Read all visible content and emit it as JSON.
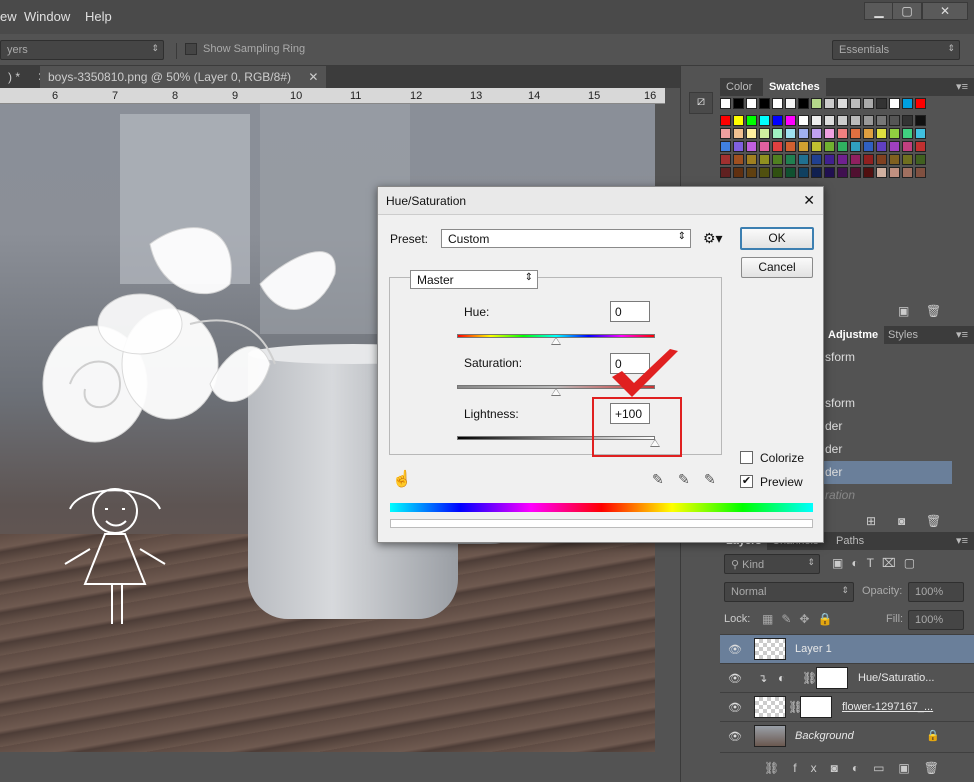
{
  "menu": {
    "items": [
      "ew",
      "Window",
      "Help"
    ]
  },
  "window_controls": {
    "minimize": "▁",
    "restore": "▢",
    "close": "✕"
  },
  "options_bar": {
    "sample_dropdown": "yers",
    "show_sampling_ring": "Show Sampling Ring",
    "workspace": "Essentials"
  },
  "doc_tabs": {
    "prev_tab": ") *",
    "active_tab": "boys-3350810.png @ 50% (Layer 0, RGB/8#)"
  },
  "ruler": {
    "ticks": [
      "6",
      "7",
      "8",
      "9",
      "10",
      "11",
      "12",
      "13",
      "14",
      "15",
      "16"
    ]
  },
  "swatches_panel": {
    "tabs": [
      "Color",
      "Swatches"
    ],
    "colors": [
      [
        "#ffffff",
        "#000000",
        "#ffffff",
        "#000000",
        "#ffffff",
        "#f5f5f5",
        "#000000",
        "#b5d88a",
        "#cccccc",
        "#dddddd",
        "#bbbbbb",
        "#aaaaaa",
        "#333333",
        "#ffffff",
        "#00a0e0",
        "#ff0000"
      ],
      [
        "#ff0000",
        "#ffff00",
        "#00ff00",
        "#00ffff",
        "#0000ff",
        "#ff00ff",
        "#ffffff",
        "#eeeeee",
        "#dddddd",
        "#cccccc",
        "#bbbbbb",
        "#999999",
        "#777777",
        "#555555",
        "#333333",
        "#111111"
      ],
      [
        "#f0a0a0",
        "#f0c090",
        "#fff0a0",
        "#d0f0a0",
        "#a0f0c0",
        "#a0e0f0",
        "#a0b0f0",
        "#c0a0f0",
        "#f0a0e0",
        "#f08080",
        "#e07040",
        "#e0a040",
        "#e0e040",
        "#90d040",
        "#40d080",
        "#40c0e0"
      ],
      [
        "#4080e0",
        "#8060e0",
        "#c060e0",
        "#e060a0",
        "#e04040",
        "#d06030",
        "#d0a030",
        "#c0c030",
        "#70b030",
        "#30b060",
        "#30a0c0",
        "#3060c0",
        "#6040c0",
        "#a040c0",
        "#c04080",
        "#c03030"
      ],
      [
        "#a03030",
        "#a05020",
        "#a08020",
        "#909020",
        "#508020",
        "#208050",
        "#207090",
        "#204090",
        "#402090",
        "#702090",
        "#902060",
        "#902020",
        "#804020",
        "#806020",
        "#707020",
        "#406020"
      ],
      [
        "#602020",
        "#603010",
        "#604010",
        "#505010",
        "#305010",
        "#105030",
        "#104060",
        "#102050",
        "#201050",
        "#401050",
        "#501030",
        "#501010",
        "#d0b0a0",
        "#c09080",
        "#a07060",
        "#805040"
      ]
    ]
  },
  "adjustments_panel": {
    "tabs": [
      "Adjustme",
      "Styles"
    ],
    "items": [
      "sform",
      "",
      "sform",
      "der",
      "der",
      "der",
      "ration"
    ]
  },
  "layers_panel": {
    "tabs": [
      "Layers",
      "Channels",
      "Paths"
    ],
    "kind_label": "Kind",
    "blend_mode": "Normal",
    "opacity_label": "Opacity:",
    "opacity_value": "100%",
    "lock_label": "Lock:",
    "fill_label": "Fill:",
    "fill_value": "100%",
    "layers": [
      {
        "name": "Layer 1"
      },
      {
        "name": "Hue/Saturatio..."
      },
      {
        "name": "flower-1297167_..."
      },
      {
        "name": "Background"
      }
    ]
  },
  "dialog": {
    "title": "Hue/Saturation",
    "close": "✕",
    "preset_label": "Preset:",
    "preset_value": "Custom",
    "ok_label": "OK",
    "cancel_label": "Cancel",
    "channel": "Master",
    "hue": {
      "label": "Hue:",
      "value": "0",
      "slider_fraction": 0.5
    },
    "saturation": {
      "label": "Saturation:",
      "value": "0",
      "slider_fraction": 0.5
    },
    "lightness": {
      "label": "Lightness:",
      "value": "+100",
      "slider_fraction": 1.0
    },
    "colorize_label": "Colorize",
    "colorize_checked": false,
    "preview_label": "Preview",
    "preview_checked": true,
    "highlight_color": "#e02020"
  }
}
